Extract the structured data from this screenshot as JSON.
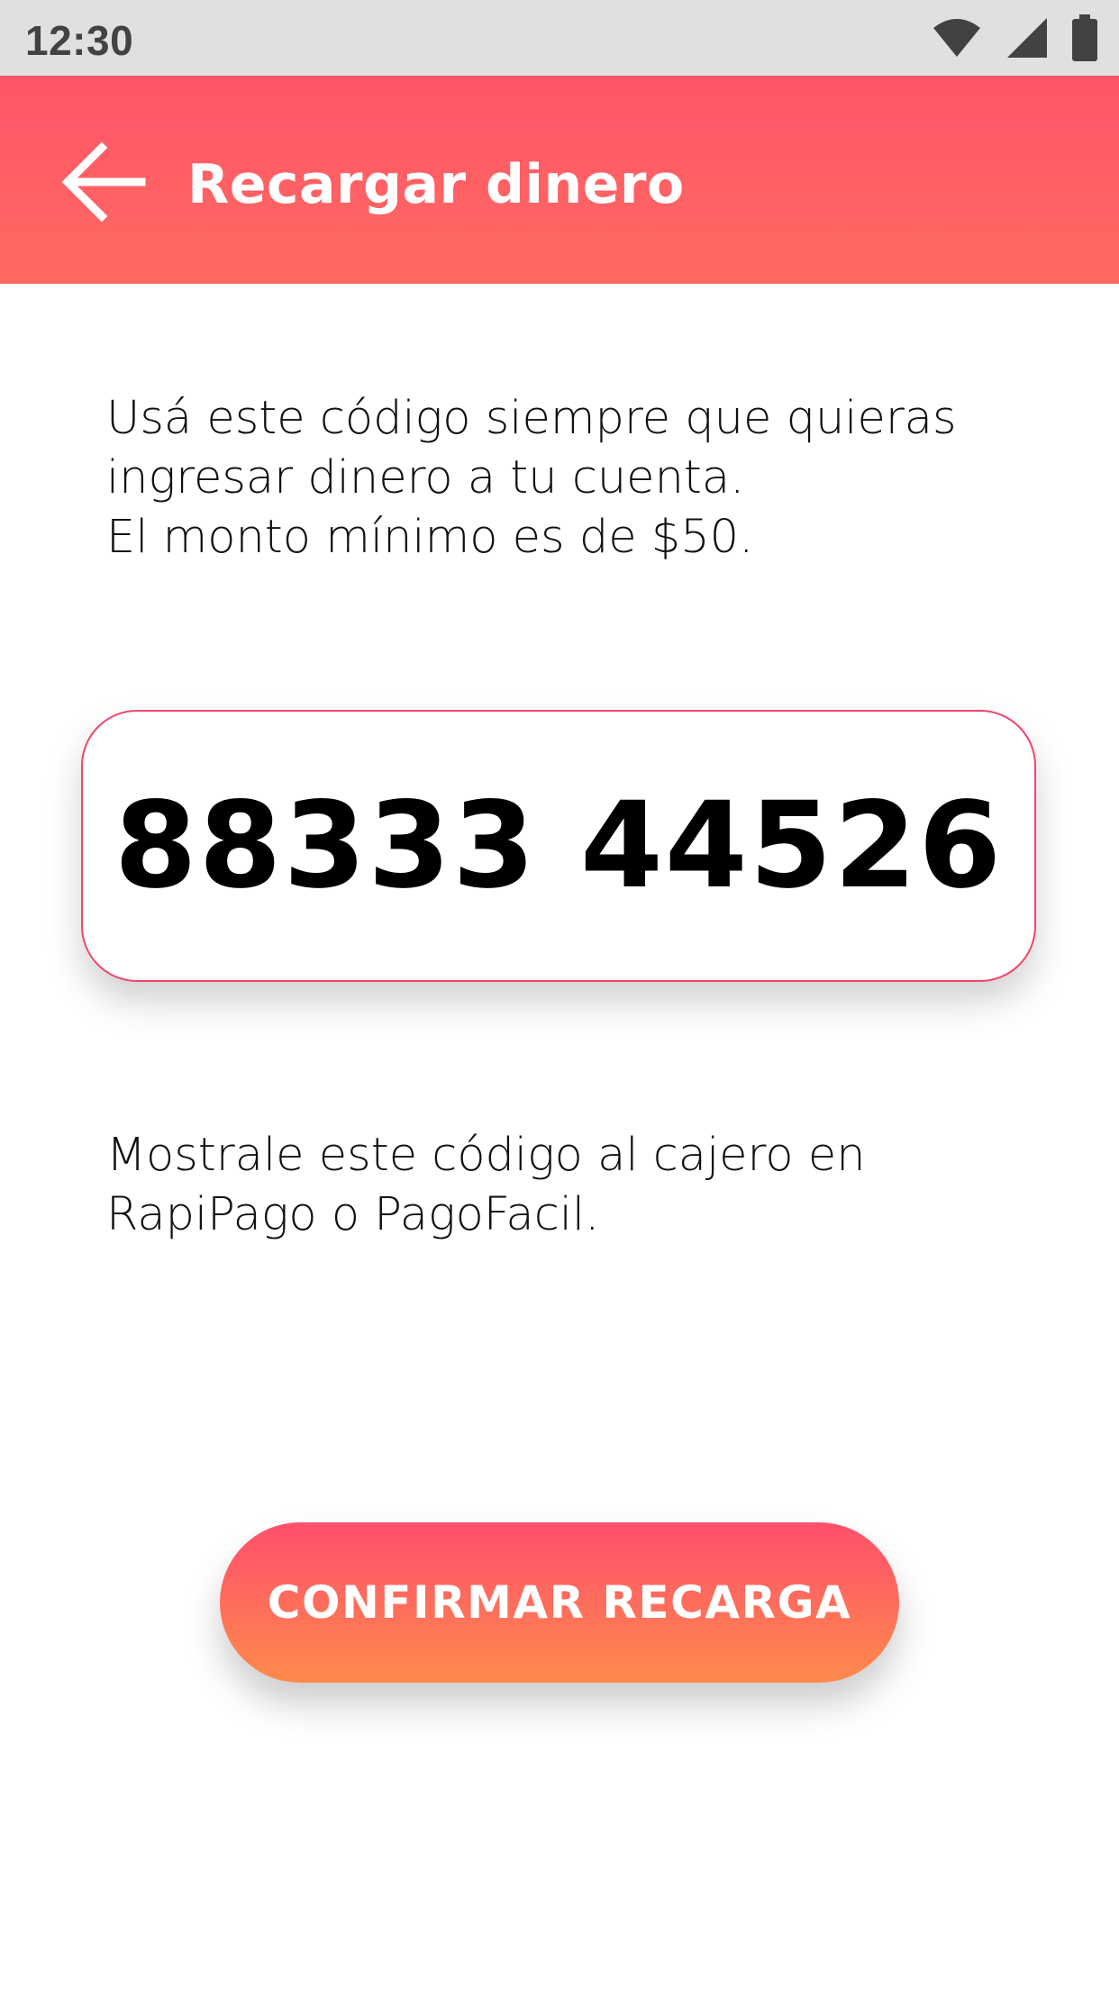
{
  "status_bar": {
    "time": "12:30",
    "icons": [
      "wifi-icon",
      "cellular-signal-icon",
      "battery-icon"
    ]
  },
  "app_bar": {
    "back_icon": "arrow-left-icon",
    "title": "Recargar dinero"
  },
  "intro": {
    "lines": [
      "Usá este código siempre que quieras",
      "ingresar dinero a tu cuenta.",
      "El monto mínimo es de $50."
    ]
  },
  "code": {
    "value": "88333 44526"
  },
  "instructions": {
    "lines": [
      "Mostrale este código al cajero en",
      "RapiPago o PagoFacil."
    ]
  },
  "confirm_button": {
    "label": "CONFIRMAR RECARGA"
  },
  "colors": {
    "app_bar": "#ff5a66",
    "card_border": "#f0466a",
    "button_top": "#ff4f6c",
    "button_bottom": "#ff8a4c",
    "status_bar": "#e0e0e0"
  }
}
